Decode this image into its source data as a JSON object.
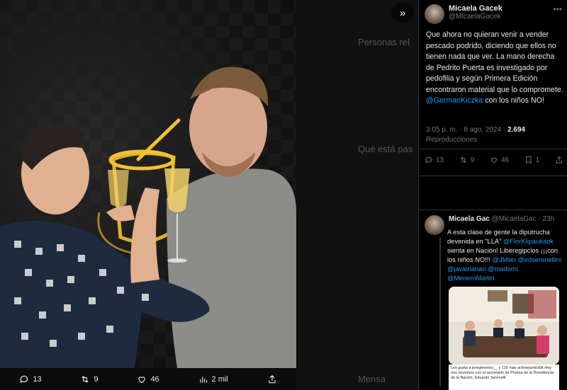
{
  "media_viewer": {
    "dimmed_sidebar": {
      "personas": "Personas rel",
      "que_esta": "Qué está pas",
      "mensajes": "Mensa"
    },
    "actions": {
      "replies": "13",
      "reposts": "9",
      "likes": "46",
      "views": "2 mil"
    }
  },
  "tweet": {
    "author_name": "Micaela Gacek",
    "author_handle": "@MicaelaGacek",
    "text_before_link": "Que ahora no quieran venir a vender pescado podrido, diciendo que ellos no tienen nada que ver.  La mano derecha de Pedrito Puerta es investigado por pedofilia y según Primera Edición encontraron material que lo compromete.",
    "link_mention": "@GermanKiczka",
    "text_after_link": "con los niños NO!",
    "time": "3:05 p. m. · 8 ago. 2024 ·",
    "views_count": "2.694",
    "views_label": "Reproducciones",
    "stats": {
      "replies": "13",
      "reposts": "9",
      "likes": "46",
      "bookmarks": "1"
    }
  },
  "reply": {
    "author_name": "Micaela Gac",
    "author_meta": "@MicaelaGac · 23h",
    "text_1": "A esta clase de gente la diputrucha devenida  en \"LLA\"",
    "mention_1": "@FlorKlipaukaok",
    "text_2": "sienta en Nación!  Liberegipcios ¡¡¡con los niños NO!!!",
    "mention_2": "@JMilei",
    "mention_3": "@edserenellini",
    "mention_4": "@javierlanari",
    "mention_5": "@madorni",
    "mention_6": "@MenemMartin",
    "ig_caption": "Les gusta a joregimenez__ y 116 más activarjuntos0k Hoy nos reunimos con el secretario de Prensa de la Presidencia de la Nación, Eduardo Serenelli"
  },
  "colors": {
    "accent": "#1d9bf0",
    "background": "#000000",
    "muted": "#71767b"
  }
}
